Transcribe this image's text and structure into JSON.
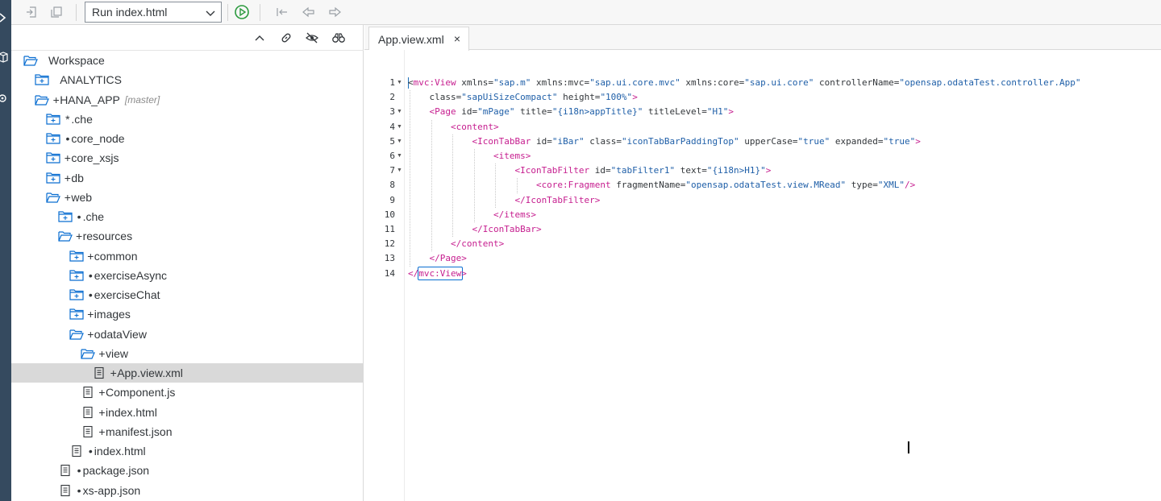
{
  "activity_bar": {
    "icons": [
      "run-arrow-icon",
      "cube-icon",
      "gear-icon"
    ]
  },
  "toolbar": {
    "icons": [
      "save-icon",
      "save-all-icon",
      "run-icon",
      "history-back-icon",
      "navigate-back-icon",
      "navigate-forward-icon"
    ],
    "run_config": "Run index.html"
  },
  "explorer": {
    "tools": [
      "collapse-all-icon",
      "link-icon",
      "hide-hidden-files-icon",
      "binoculars-icon"
    ],
    "tree": [
      {
        "label": "Workspace",
        "mark": "",
        "icon": "folder-open",
        "branch": ""
      },
      {
        "label": "ANALYTICS",
        "mark": "",
        "icon": "folder-closed",
        "branch": ""
      },
      {
        "label": "HANA_APP",
        "mark": "+",
        "icon": "folder-open",
        "branch": "[master]"
      },
      {
        "label": ".che",
        "mark": "*",
        "icon": "folder-closed",
        "branch": ""
      },
      {
        "label": "core_node",
        "mark": "•",
        "icon": "folder-closed",
        "branch": ""
      },
      {
        "label": "core_xsjs",
        "mark": "+",
        "icon": "folder-closed",
        "branch": ""
      },
      {
        "label": "db",
        "mark": "+",
        "icon": "folder-closed",
        "branch": ""
      },
      {
        "label": "web",
        "mark": "+",
        "icon": "folder-open",
        "branch": ""
      },
      {
        "label": ".che",
        "mark": "•",
        "icon": "folder-closed",
        "branch": ""
      },
      {
        "label": "resources",
        "mark": "+",
        "icon": "folder-open",
        "branch": ""
      },
      {
        "label": "common",
        "mark": "+",
        "icon": "folder-closed",
        "branch": ""
      },
      {
        "label": "exerciseAsync",
        "mark": "•",
        "icon": "folder-closed",
        "branch": ""
      },
      {
        "label": "exerciseChat",
        "mark": "•",
        "icon": "folder-closed",
        "branch": ""
      },
      {
        "label": "images",
        "mark": "+",
        "icon": "folder-closed",
        "branch": ""
      },
      {
        "label": "odataView",
        "mark": "+",
        "icon": "folder-open",
        "branch": ""
      },
      {
        "label": "view",
        "mark": "+",
        "icon": "folder-open",
        "branch": ""
      },
      {
        "label": "App.view.xml",
        "mark": "+",
        "icon": "file",
        "branch": ""
      },
      {
        "label": "Component.js",
        "mark": "+",
        "icon": "file",
        "branch": ""
      },
      {
        "label": "index.html",
        "mark": "+",
        "icon": "file",
        "branch": ""
      },
      {
        "label": "manifest.json",
        "mark": "+",
        "icon": "file",
        "branch": ""
      },
      {
        "label": "index.html",
        "mark": "•",
        "icon": "file",
        "branch": ""
      },
      {
        "label": "package.json",
        "mark": "•",
        "icon": "file",
        "branch": ""
      },
      {
        "label": "xs-app.json",
        "mark": "•",
        "icon": "file",
        "branch": ""
      }
    ]
  },
  "editor": {
    "tab_label": "App.view.xml",
    "tab_close": "×",
    "lines": [
      {
        "n": "1",
        "fold": true,
        "tokens": [
          [
            "pun",
            "<"
          ],
          [
            "tag",
            "mvc:View"
          ],
          [
            "attr",
            " xmlns="
          ],
          [
            "val",
            "\"sap.m\""
          ],
          [
            "attr",
            " xmlns:mvc="
          ],
          [
            "val",
            "\"sap.ui.core.mvc\""
          ],
          [
            "attr",
            " xmlns:core="
          ],
          [
            "val",
            "\"sap.ui.core\""
          ],
          [
            "attr",
            " controllerName="
          ],
          [
            "val",
            "\"opensap.odataTest.controller.App\""
          ]
        ]
      },
      {
        "n": "2",
        "fold": false,
        "tokens": [
          [
            "attr",
            "    class="
          ],
          [
            "val",
            "\"sapUiSizeCompact\""
          ],
          [
            "attr",
            " height="
          ],
          [
            "val",
            "\"100%\""
          ],
          [
            "tag",
            ">"
          ]
        ]
      },
      {
        "n": "3",
        "fold": true,
        "tokens": [
          [
            "tag",
            "    <Page"
          ],
          [
            "attr",
            " id="
          ],
          [
            "val",
            "\"mPage\""
          ],
          [
            "attr",
            " title="
          ],
          [
            "val",
            "\"{i18n>appTitle}\""
          ],
          [
            "attr",
            " titleLevel="
          ],
          [
            "val",
            "\"H1\""
          ],
          [
            "tag",
            ">"
          ]
        ]
      },
      {
        "n": "4",
        "fold": true,
        "tokens": [
          [
            "tag",
            "        <content>"
          ]
        ]
      },
      {
        "n": "5",
        "fold": true,
        "tokens": [
          [
            "tag",
            "            <IconTabBar"
          ],
          [
            "attr",
            " id="
          ],
          [
            "val",
            "\"iBar\""
          ],
          [
            "attr",
            " class="
          ],
          [
            "val",
            "\"iconTabBarPaddingTop\""
          ],
          [
            "attr",
            " upperCase="
          ],
          [
            "val",
            "\"true\""
          ],
          [
            "attr",
            " expanded="
          ],
          [
            "val",
            "\"true\""
          ],
          [
            "tag",
            ">"
          ]
        ]
      },
      {
        "n": "6",
        "fold": true,
        "tokens": [
          [
            "tag",
            "                <items>"
          ]
        ]
      },
      {
        "n": "7",
        "fold": true,
        "tokens": [
          [
            "tag",
            "                    <IconTabFilter"
          ],
          [
            "attr",
            " id="
          ],
          [
            "val",
            "\"tabFilter1\""
          ],
          [
            "attr",
            " text="
          ],
          [
            "val",
            "\"{i18n>H1}\""
          ],
          [
            "tag",
            ">"
          ]
        ]
      },
      {
        "n": "8",
        "fold": false,
        "tokens": [
          [
            "tag",
            "                        <core:Fragment"
          ],
          [
            "attr",
            " fragmentName="
          ],
          [
            "val",
            "\"opensap.odataTest.view.MRead\""
          ],
          [
            "attr",
            " type="
          ],
          [
            "val",
            "\"XML\""
          ],
          [
            "tag",
            "/>"
          ]
        ]
      },
      {
        "n": "9",
        "fold": false,
        "tokens": [
          [
            "tag",
            "                    </IconTabFilter>"
          ]
        ]
      },
      {
        "n": "10",
        "fold": false,
        "tokens": [
          [
            "tag",
            "                </items>"
          ]
        ]
      },
      {
        "n": "11",
        "fold": false,
        "tokens": [
          [
            "tag",
            "            </IconTabBar>"
          ]
        ]
      },
      {
        "n": "12",
        "fold": false,
        "tokens": [
          [
            "tag",
            "        </content>"
          ]
        ]
      },
      {
        "n": "13",
        "fold": false,
        "tokens": [
          [
            "tag",
            "    </Page>"
          ]
        ]
      },
      {
        "n": "14",
        "fold": false,
        "tokens": [
          [
            "tag",
            "</"
          ],
          [
            "tag",
            "mvc:View"
          ],
          [
            "tag",
            ">"
          ]
        ]
      }
    ]
  },
  "cursor": "I"
}
